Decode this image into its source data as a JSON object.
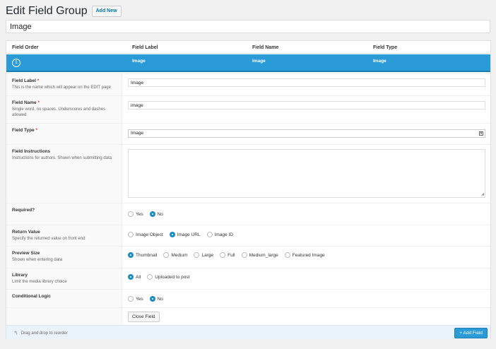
{
  "header": {
    "title": "Edit Field Group",
    "add_new_label": "Add New"
  },
  "group_title_value": "Image",
  "columns": {
    "field_order": "Field Order",
    "field_label": "Field Label",
    "field_name": "Field Name",
    "field_type": "Field Type"
  },
  "active_field": {
    "order": "1",
    "label": "Image",
    "name": "image",
    "type": "Image"
  },
  "settings": {
    "field_label": {
      "title": "Field Label",
      "required_mark": "*",
      "desc": "This is the name which will appear on the EDIT page",
      "value": "Image"
    },
    "field_name": {
      "title": "Field Name",
      "required_mark": "*",
      "desc": "Single word, no spaces. Underscores and dashes allowed",
      "value": "image"
    },
    "field_type": {
      "title": "Field Type",
      "required_mark": "*",
      "value": "Image"
    },
    "field_instructions": {
      "title": "Field Instructions",
      "desc": "Instructions for authors. Shown when submitting data",
      "value": ""
    },
    "required": {
      "title": "Required?",
      "options": [
        "Yes",
        "No"
      ],
      "selected": "No"
    },
    "return_value": {
      "title": "Return Value",
      "desc": "Specify the returned value on front end",
      "options": [
        "Image Object",
        "Image URL",
        "Image ID"
      ],
      "selected": "Image URL"
    },
    "preview_size": {
      "title": "Preview Size",
      "desc": "Shown when entering data",
      "options": [
        "Thumbnail",
        "Medium",
        "Large",
        "Full",
        "Medium_large",
        "Featured Image"
      ],
      "selected": "Thumbnail"
    },
    "library": {
      "title": "Library",
      "desc": "Limit the media library choice",
      "options": [
        "All",
        "Uploaded to post"
      ],
      "selected": "All"
    },
    "conditional_logic": {
      "title": "Conditional Logic",
      "options": [
        "Yes",
        "No"
      ],
      "selected": "No"
    },
    "close_field_label": "Close Field"
  },
  "footer": {
    "drag_hint": "Drag and drop to reorder",
    "add_field_label": "+ Add Field"
  },
  "colors": {
    "accent": "#2a9bd6",
    "radio_checked": "#1e8cbe"
  }
}
